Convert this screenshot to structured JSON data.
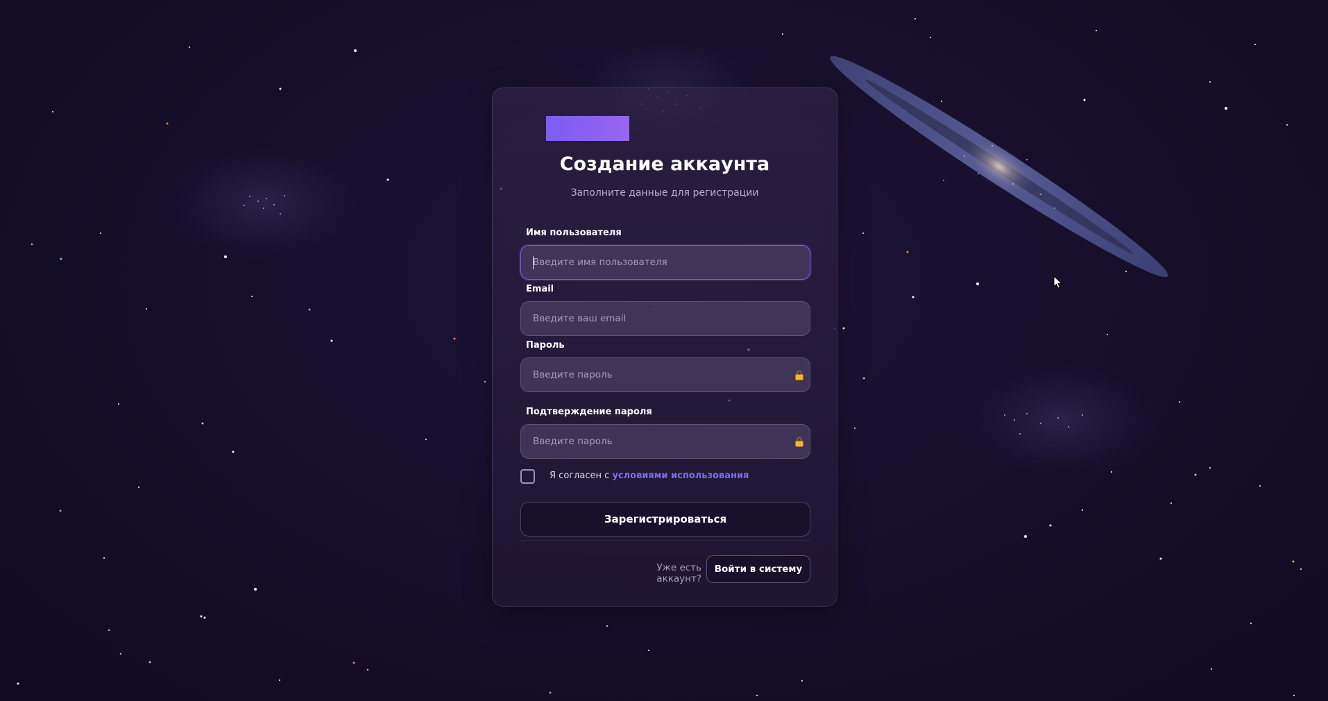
{
  "form": {
    "title": "Создание аккаунта",
    "subtitle": "Заполните данные для регистрации",
    "fields": [
      {
        "label": "Имя пользователя",
        "placeholder": "Введите имя пользователя",
        "value": ""
      },
      {
        "label": "Email",
        "placeholder": "Введите ваш email",
        "value": ""
      },
      {
        "label": "Пароль",
        "placeholder": "Введите пароль",
        "value": ""
      },
      {
        "label": "Подтверждение пароля",
        "placeholder": "Введите пароль",
        "value": ""
      }
    ],
    "agree_text": "Я согласен с ",
    "terms_link": "условиями использования",
    "terms_checked": false,
    "submit_label": "Зарегистрироваться"
  },
  "footer": {
    "have_account": "Уже есть аккаунт?",
    "login_label": "Войти в систему"
  },
  "icons": {
    "password_icon": "lock-icon",
    "confirm_icon": "lock-icon",
    "logo": "logo-placeholder"
  },
  "colors": {
    "accent": "#7b5cf3",
    "link": "#7d6bf2",
    "lock": "#f5b820",
    "background": "#170f2c"
  }
}
